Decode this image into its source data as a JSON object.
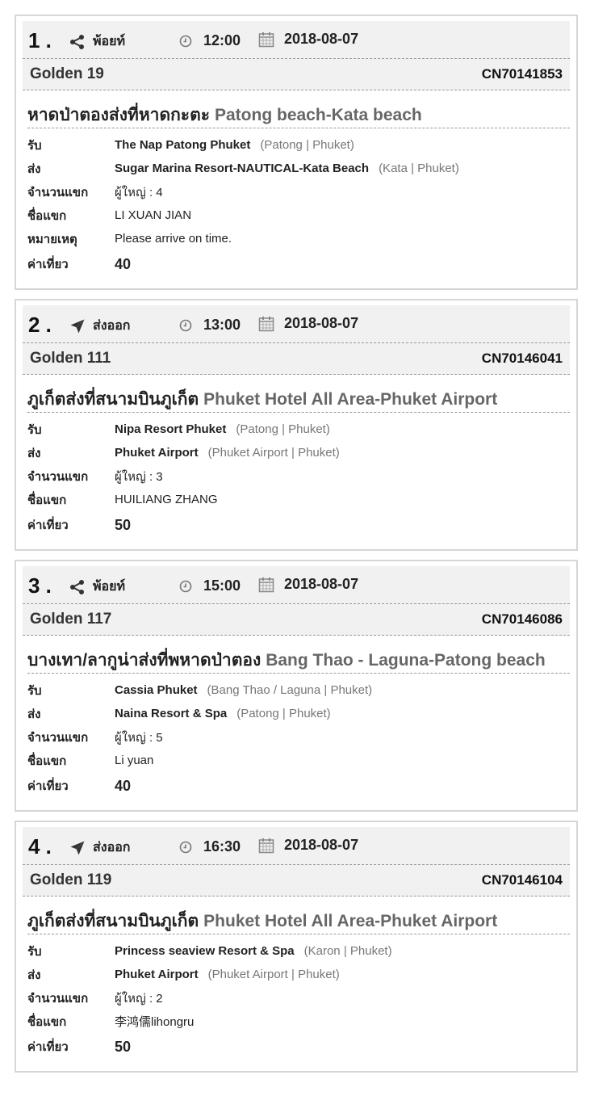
{
  "labels": {
    "pickup": "รับ",
    "dropoff": "ส่ง",
    "passengers": "จำนวนแขก",
    "guest_name": "ชื่อแขก",
    "note": "หมายเหตุ",
    "price": "ค่าเที่ยว"
  },
  "bookings": [
    {
      "number": "1 .",
      "type_label": "พ้อยท์",
      "type_icon": "share-icon",
      "time": "12:00",
      "date": "2018-08-07",
      "car": "Golden 19",
      "code": "CN70141853",
      "route_th": "หาดป่าตองส่งที่หาดกะตะ",
      "route_en": "Patong beach-Kata beach",
      "pickup": "The Nap Patong Phuket",
      "pickup_loc": "(Patong | Phuket)",
      "dropoff": "Sugar Marina Resort-NAUTICAL-Kata Beach",
      "dropoff_loc": "(Kata | Phuket)",
      "passengers": "ผู้ใหญ่ : 4",
      "guest_name": "LI XUAN JIAN",
      "note": "Please arrive on time.",
      "price": "40"
    },
    {
      "number": "2 .",
      "type_label": "ส่งออก",
      "type_icon": "plane-icon",
      "time": "13:00",
      "date": "2018-08-07",
      "car": "Golden 111",
      "code": "CN70146041",
      "route_th": "ภูเก็ตส่งที่สนามบินภูเก็ต",
      "route_en": "Phuket Hotel All Area-Phuket Airport",
      "pickup": "Nipa Resort Phuket",
      "pickup_loc": "(Patong | Phuket)",
      "dropoff": "Phuket Airport",
      "dropoff_loc": "(Phuket Airport | Phuket)",
      "passengers": "ผู้ใหญ่ : 3",
      "guest_name": "HUILIANG ZHANG",
      "price": "50"
    },
    {
      "number": "3 .",
      "type_label": "พ้อยท์",
      "type_icon": "share-icon",
      "time": "15:00",
      "date": "2018-08-07",
      "car": "Golden 117",
      "code": "CN70146086",
      "route_th": "บางเทา/ลากูน่าส่งที่พหาดป่าตอง",
      "route_en": "Bang Thao - Laguna-Patong beach",
      "pickup": "Cassia Phuket",
      "pickup_loc": "(Bang Thao / Laguna | Phuket)",
      "dropoff": "Naina Resort & Spa",
      "dropoff_loc": "(Patong | Phuket)",
      "passengers": "ผู้ใหญ่ : 5",
      "guest_name": "Li yuan",
      "price": "40"
    },
    {
      "number": "4 .",
      "type_label": "ส่งออก",
      "type_icon": "plane-icon",
      "time": "16:30",
      "date": "2018-08-07",
      "car": "Golden 119",
      "code": "CN70146104",
      "route_th": "ภูเก็ตส่งที่สนามบินภูเก็ต",
      "route_en": "Phuket Hotel All Area-Phuket Airport",
      "pickup": "Princess seaview Resort & Spa",
      "pickup_loc": "(Karon | Phuket)",
      "dropoff": "Phuket Airport",
      "dropoff_loc": "(Phuket Airport | Phuket)",
      "passengers": "ผู้ใหญ่ : 2",
      "guest_name": "李鸿儒lihongru",
      "price": "50"
    }
  ]
}
